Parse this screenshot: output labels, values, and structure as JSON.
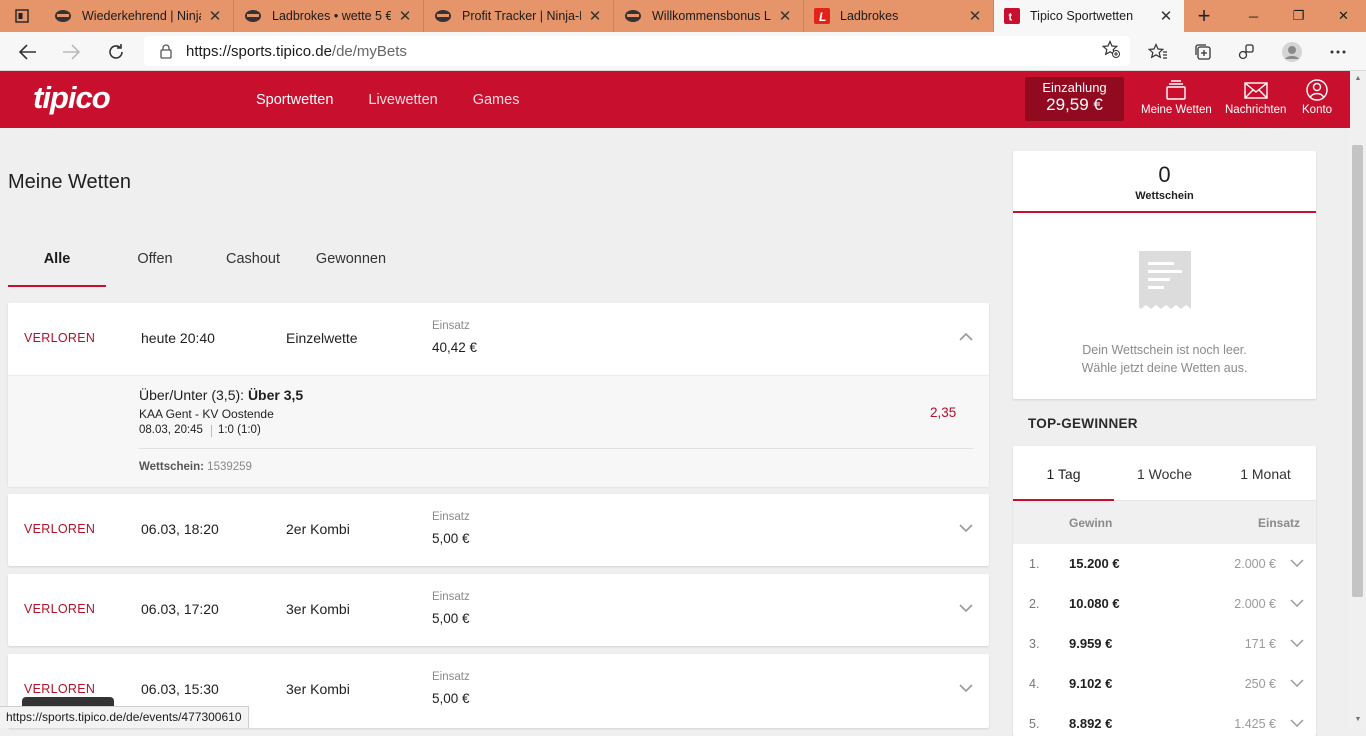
{
  "browser": {
    "tabs": [
      {
        "title": "Wiederkehrend | Ninja-",
        "icon": "ninja-icon"
      },
      {
        "title": "Ladbrokes • wette 5 € e",
        "icon": "ninja-icon"
      },
      {
        "title": "Profit Tracker | Ninja-Be",
        "icon": "ninja-icon"
      },
      {
        "title": "Willkommensbonus Lac",
        "icon": "ninja-icon"
      },
      {
        "title": "Ladbrokes",
        "icon": "ladbrokes-icon"
      },
      {
        "title": "Tipico Sportwetten",
        "icon": "tipico-icon"
      }
    ],
    "url_host": "https://sports.tipico.de",
    "url_path": "/de/myBets",
    "status_url": "https://sports.tipico.de/de/events/477300610",
    "tab_close": "✕",
    "new_tab": "+"
  },
  "header": {
    "logo": "tipico",
    "nav": [
      "Sportwetten",
      "Livewetten",
      "Games"
    ],
    "deposit_label": "Einzahlung",
    "deposit_amount": "29,59 €",
    "my_bets": "Meine Wetten",
    "messages": "Nachrichten",
    "account": "Konto"
  },
  "page": {
    "title": "Meine Wetten",
    "filters": [
      "Alle",
      "Offen",
      "Cashout",
      "Gewonnen"
    ]
  },
  "bets": [
    {
      "status": "VERLOREN",
      "date": "heute 20:40",
      "type": "Einzelwette",
      "stake_label": "Einsatz",
      "stake": "40,42 €",
      "expanded": true,
      "detail": {
        "market": "Über/Unter (3,5): ",
        "selection": "Über 3,5",
        "match": "KAA Gent - KV Oostende",
        "kickoff": "08.03, 20:45",
        "result": "1:0 (1:0)",
        "odds": "2,35",
        "slip_label": "Wettschein: ",
        "slip_id": "1539259"
      }
    },
    {
      "status": "VERLOREN",
      "date": "06.03, 18:20",
      "type": "2er Kombi",
      "stake_label": "Einsatz",
      "stake": "5,00 €"
    },
    {
      "status": "VERLOREN",
      "date": "06.03, 17:20",
      "type": "3er Kombi",
      "stake_label": "Einsatz",
      "stake": "5,00 €"
    },
    {
      "status": "VERLOREN",
      "date": "06.03, 15:30",
      "type": "3er Kombi",
      "stake_label": "Einsatz",
      "stake": "5,00 €"
    }
  ],
  "betslip": {
    "count": "0",
    "label": "Wettschein",
    "empty_line1": "Dein Wettschein ist noch leer.",
    "empty_line2": "Wähle jetzt deine Wetten aus."
  },
  "top_winners": {
    "title": "TOP-GEWINNER",
    "periods": [
      "1 Tag",
      "1 Woche",
      "1 Monat"
    ],
    "col_win": "Gewinn",
    "col_stake": "Einsatz",
    "rows": [
      {
        "rank": "1.",
        "win": "15.200 €",
        "stake": "2.000 €"
      },
      {
        "rank": "2.",
        "win": "10.080 €",
        "stake": "2.000 €"
      },
      {
        "rank": "3.",
        "win": "9.959 €",
        "stake": "171 €"
      },
      {
        "rank": "4.",
        "win": "9.102 €",
        "stake": "250 €"
      },
      {
        "rank": "5.",
        "win": "8.892 €",
        "stake": "1.425 €"
      }
    ]
  },
  "colors": {
    "brand": "#c8102e",
    "lost": "#b0102a",
    "tabbar": "#e6956a"
  }
}
